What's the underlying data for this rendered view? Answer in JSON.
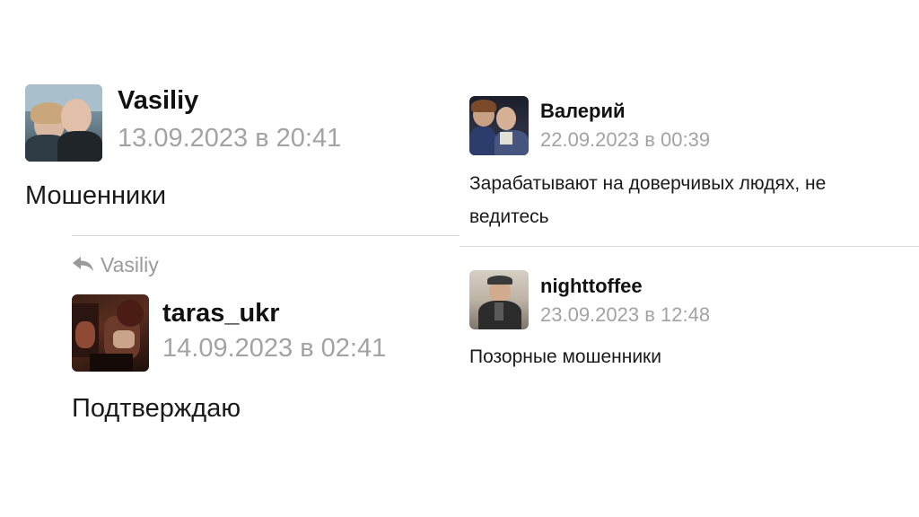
{
  "left_thread": {
    "comment": {
      "username": "Vasiliy",
      "datetime": "13.09.2023 в 20:41",
      "text": "Мошенники"
    },
    "reply": {
      "reply_to": "Vasiliy",
      "username": "taras_ukr",
      "datetime": "14.09.2023 в 02:41",
      "text": "Подтверждаю"
    }
  },
  "right_thread": {
    "comments": [
      {
        "username": "Валерий",
        "datetime": "22.09.2023 в 00:39",
        "text_line1": "Зарабатывают на доверчивых людях, не",
        "text_line2": "ведитесь"
      },
      {
        "username": "nighttoffee",
        "datetime": "23.09.2023 в 12:48",
        "text": "Позорные мошенники"
      }
    ]
  },
  "icons": {
    "reply": "reply-arrow-icon"
  }
}
